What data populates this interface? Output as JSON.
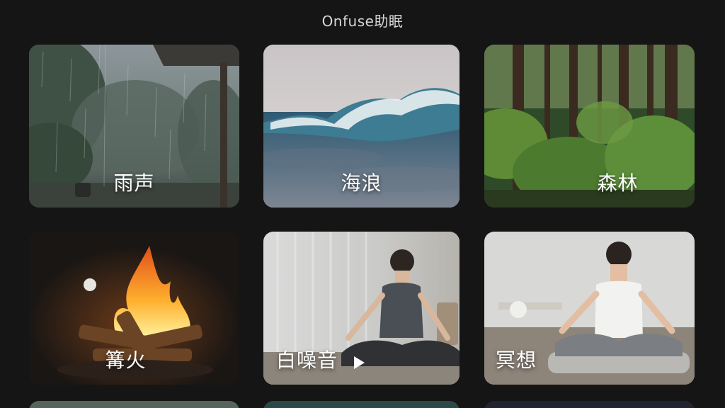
{
  "app": {
    "title": "Onfuse助眠"
  },
  "tiles": [
    {
      "label": "雨声",
      "icon": "rain-scene"
    },
    {
      "label": "海浪",
      "icon": "wave-scene"
    },
    {
      "label": "森林",
      "icon": "forest-scene"
    },
    {
      "label": "篝火",
      "icon": "campfire-scene"
    },
    {
      "label": "白噪音",
      "icon": "meditation-scene"
    },
    {
      "label": "冥想",
      "icon": "meditation-scene"
    }
  ],
  "colors": {
    "background": "#151515",
    "title": "#d8d8d8",
    "label": "#ffffff"
  }
}
